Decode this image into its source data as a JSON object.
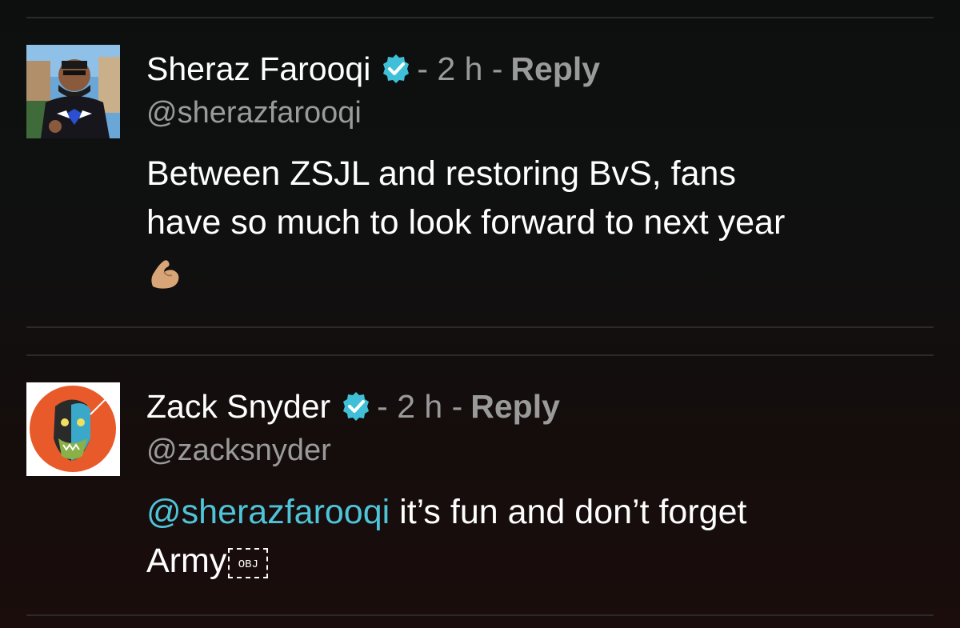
{
  "comments": [
    {
      "name": "Sheraz Farooqi",
      "separator1": "- 2 h -",
      "reply_label": "Reply",
      "handle": "@sherazfarooqi",
      "text_line1": "Between ZSJL and restoring BvS, fans",
      "text_line2": "have so much to look forward to next year",
      "emoji": "flexed-biceps-emoji",
      "avatar": "user-photo-avatar"
    },
    {
      "name": "Zack Snyder",
      "separator1": "- 2 h -",
      "reply_label": "Reply",
      "handle": "@zacksnyder",
      "mention": "@sherazfarooqi",
      "text_after_mention": " it’s fun and don’t forget",
      "text_line2": "Army",
      "obj_placeholder": "OBJ",
      "avatar": "illustrated-zombie-avatar"
    }
  ],
  "colors": {
    "verified_badge": "#3fc0d8",
    "mention": "#4fc3d8",
    "meta_text": "#9a9a9a",
    "background": "#0d0f0f"
  }
}
